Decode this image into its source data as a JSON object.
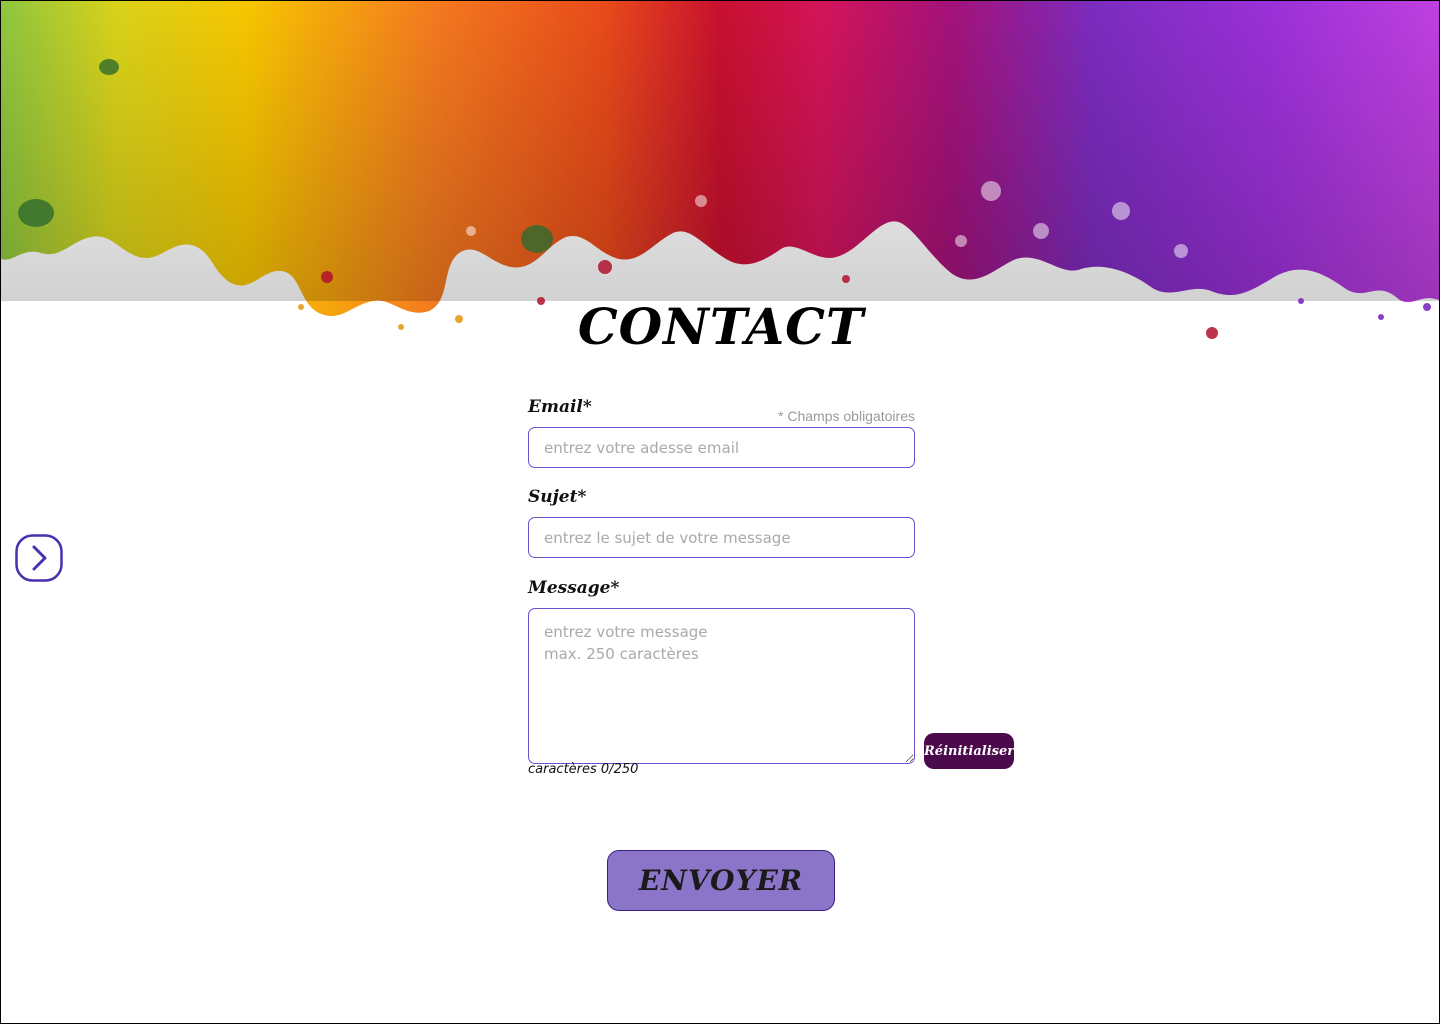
{
  "page": {
    "title": "CONTACT",
    "required_note": "* Champs obligatoires"
  },
  "form": {
    "email": {
      "label": "Email*",
      "placeholder": "entrez votre adesse email",
      "value": ""
    },
    "subject": {
      "label": "Sujet*",
      "placeholder": "entrez le sujet de votre message",
      "value": ""
    },
    "message": {
      "label": "Message*",
      "placeholder": "entrez votre message\nmax. 250 caractères",
      "value": ""
    },
    "counter": "caractères 0/250",
    "reset_label": "Réinitialiser",
    "submit_label": "ENVOYER"
  },
  "nav": {
    "next_icon": "chevron-right-icon"
  },
  "colors": {
    "accent": "#6f4fd0",
    "submit_bg": "#8b75c9",
    "reset_bg": "#4b0a4c",
    "banner": [
      "#8dc63f",
      "#f7c600",
      "#f47a1f",
      "#c8102e",
      "#d4145a",
      "#7b2cbf",
      "#c040e0"
    ]
  }
}
